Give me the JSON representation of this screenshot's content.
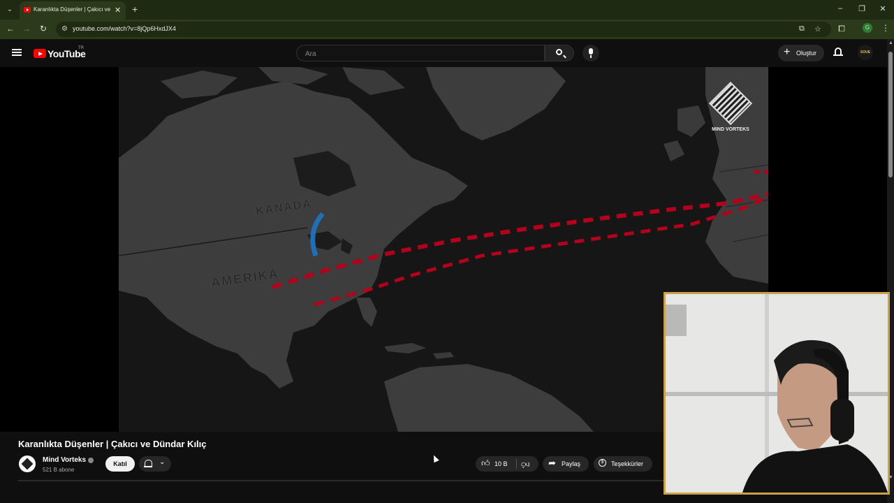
{
  "browser": {
    "tab_title": "Karanlıkta Düşenler | Çakıcı ve D",
    "url": "youtube.com/watch?v=8jQp6HxdJX4",
    "profile_initial": "G"
  },
  "header": {
    "logo_text": "YouTube",
    "country_code": "TR",
    "search_placeholder": "Ara",
    "create_label": "Oluştur",
    "avatar_text": "SOUE"
  },
  "player": {
    "map_labels": {
      "canada": "KANADA",
      "usa": "AMERİKA"
    },
    "watermark": "MIND VORTEKS"
  },
  "video": {
    "title": "Karanlıkta Düşenler | Çakıcı ve Dündar Kılıç",
    "channel_name": "Mind Vorteks",
    "subscribers": "521 B abone",
    "join_label": "Katıl",
    "likes": "10 B",
    "share_label": "Paylaş",
    "thanks_label": "Teşekkürler"
  },
  "colors": {
    "accent": "#ff0000",
    "route": "#b3001b",
    "webcam_border": "#c9a24a",
    "chrome_theme": "#2c3a1c"
  },
  "icons": [
    "tab-list-icon",
    "close-icon",
    "plus-icon",
    "minimize-icon",
    "restore-icon",
    "back-icon",
    "forward-icon",
    "reload-icon",
    "site-info-icon",
    "install-icon",
    "star-icon",
    "extensions-icon",
    "menu-icon",
    "hamburger-icon",
    "search-icon",
    "mic-icon",
    "bell-icon",
    "like-icon",
    "dislike-icon",
    "share-icon",
    "thanks-icon",
    "chevron-down-icon",
    "verified-icon"
  ]
}
